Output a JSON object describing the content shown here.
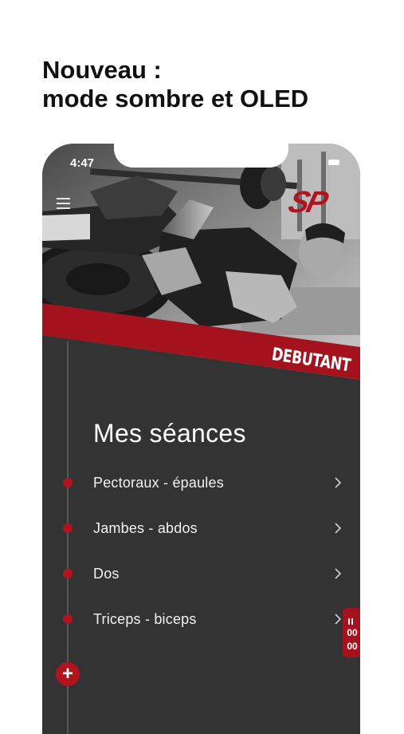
{
  "headline": {
    "line1": "Nouveau :",
    "line2": "mode sombre et OLED"
  },
  "status_bar": {
    "time": "4:47"
  },
  "header": {
    "logo_text": "SP",
    "level_badge": "DEBUTANT"
  },
  "main": {
    "title": "Mes séances",
    "sessions": [
      {
        "label": "Pectoraux - épaules"
      },
      {
        "label": "Jambes - abdos"
      },
      {
        "label": "Dos"
      },
      {
        "label": "Triceps - biceps"
      }
    ],
    "add_label": "+"
  },
  "timer": {
    "minutes": "00",
    "seconds": "00"
  },
  "colors": {
    "accent_red": "#b0141f",
    "background_dark": "#333333",
    "text_light": "#f2f2f2"
  },
  "icons": {
    "menu": "hamburger-icon",
    "chevron": "chevron-right-icon",
    "add": "plus-icon",
    "timer": "pause-icon"
  }
}
